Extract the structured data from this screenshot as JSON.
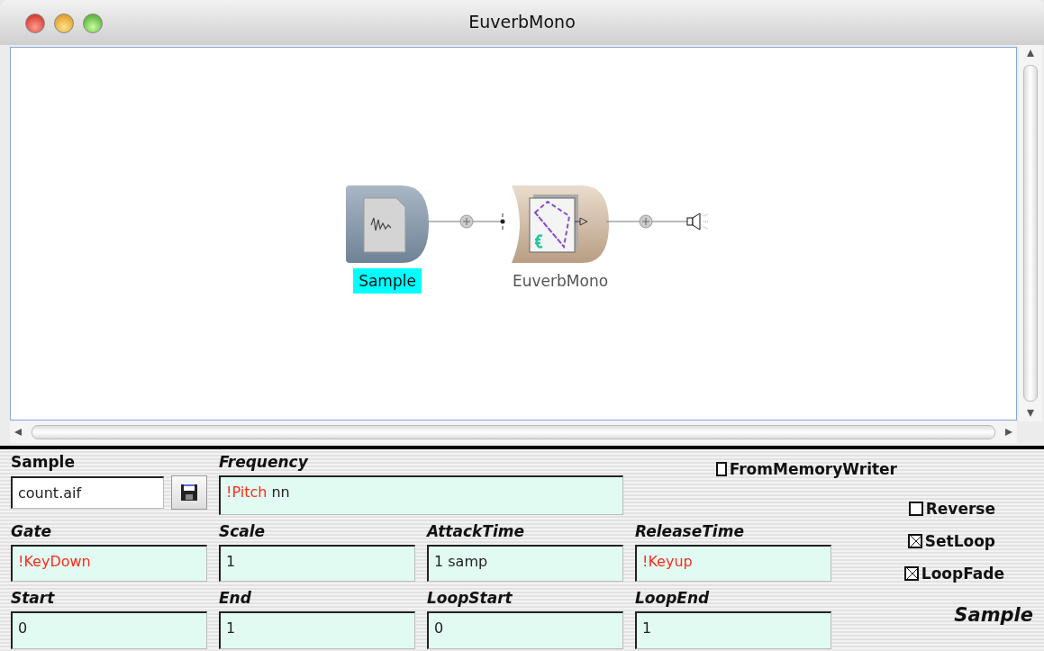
{
  "window": {
    "title": "EuverbMono"
  },
  "canvas": {
    "nodes": [
      {
        "name": "Sample",
        "kind": "sample",
        "selected": true
      },
      {
        "name": "EuverbMono",
        "kind": "effect",
        "selected": false
      }
    ]
  },
  "parameters": {
    "sample": {
      "label": "Sample",
      "value": "count.aif"
    },
    "frequency": {
      "label": "Frequency",
      "parts": [
        {
          "text": "!Pitch",
          "kind": "event"
        },
        {
          "text": " nn",
          "kind": "plain"
        }
      ]
    },
    "rows": [
      [
        {
          "label": "Gate",
          "parts": [
            {
              "text": "!KeyDown",
              "kind": "event"
            }
          ]
        },
        {
          "label": "Scale",
          "parts": [
            {
              "text": "1",
              "kind": "plain"
            }
          ]
        },
        {
          "label": "AttackTime",
          "parts": [
            {
              "text": "1 samp",
              "kind": "plain"
            }
          ]
        },
        {
          "label": "ReleaseTime",
          "parts": [
            {
              "text": "!Keyup",
              "kind": "event"
            }
          ]
        }
      ],
      [
        {
          "label": "Start",
          "parts": [
            {
              "text": "0",
              "kind": "plain"
            }
          ]
        },
        {
          "label": "End",
          "parts": [
            {
              "text": "1",
              "kind": "plain"
            }
          ]
        },
        {
          "label": "LoopStart",
          "parts": [
            {
              "text": "0",
              "kind": "plain"
            }
          ]
        },
        {
          "label": "LoopEnd",
          "parts": [
            {
              "text": "1",
              "kind": "plain"
            }
          ]
        }
      ]
    ],
    "checkboxes": [
      {
        "label": "FromMemoryWriter",
        "checked": false
      },
      {
        "label": "Reverse",
        "checked": false
      },
      {
        "label": "SetLoop",
        "checked": true
      },
      {
        "label": "LoopFade",
        "checked": true
      }
    ],
    "footer": "Sample"
  }
}
